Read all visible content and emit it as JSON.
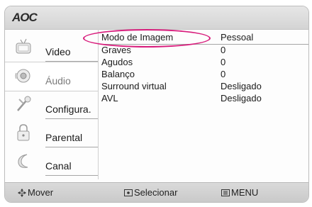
{
  "header": {
    "brand": "AOC"
  },
  "sidebar": {
    "items": [
      {
        "label": "Video"
      },
      {
        "label": "Áudio"
      },
      {
        "label": "Configura."
      },
      {
        "label": "Parental"
      },
      {
        "label": "Canal"
      }
    ],
    "active_index": 1
  },
  "settings": [
    {
      "name": "Modo de Imagem",
      "value": "Pessoal"
    },
    {
      "name": "Graves",
      "value": "0"
    },
    {
      "name": "Agudos",
      "value": "0"
    },
    {
      "name": "Balanço",
      "value": "0"
    },
    {
      "name": "Surround virtual",
      "value": "Desligado"
    },
    {
      "name": "AVL",
      "value": "Desligado"
    }
  ],
  "footer": {
    "move": "Mover",
    "select": "Selecionar",
    "menu": "MENU"
  },
  "colors": {
    "highlight": "#d81c7c"
  }
}
